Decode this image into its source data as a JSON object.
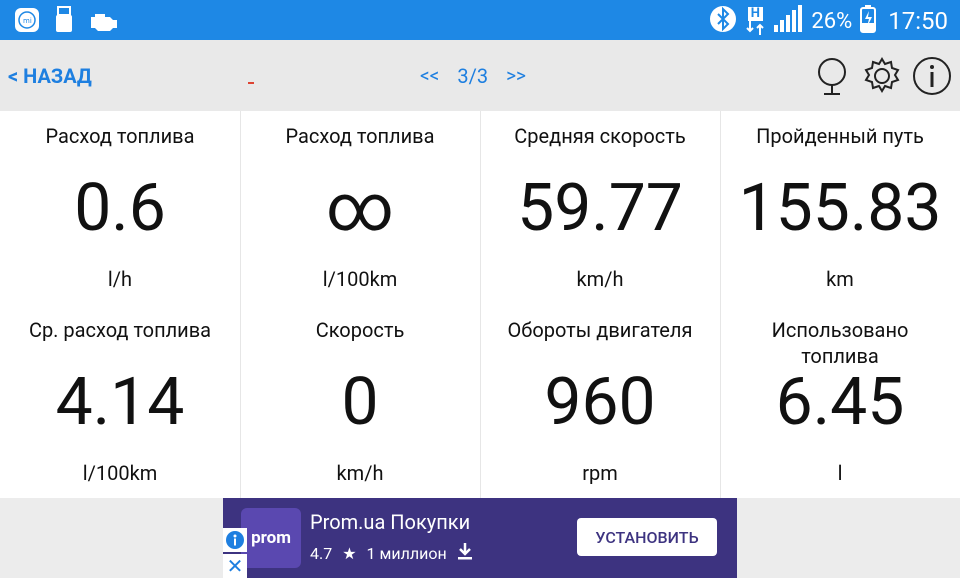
{
  "status_bar": {
    "signal_label": "H",
    "battery_percent": "26%",
    "time": "17:50"
  },
  "toolbar": {
    "back_label": "< НАЗАД",
    "prev_label": "<<",
    "page_indicator": "3/3",
    "next_label": ">>"
  },
  "cells": [
    {
      "title": "Расход топлива",
      "value": "0.6",
      "unit": "l/h"
    },
    {
      "title": "Расход топлива",
      "value": "∞",
      "unit": "l/100km"
    },
    {
      "title": "Средняя скорость",
      "value": "59.77",
      "unit": "km/h"
    },
    {
      "title": "Пройденный путь",
      "value": "155.83",
      "unit": "km"
    },
    {
      "title": "Ср. расход топлива",
      "value": "4.14",
      "unit": "l/100km"
    },
    {
      "title": "Скорость",
      "value": "0",
      "unit": "km/h"
    },
    {
      "title": "Обороты двигателя",
      "value": "960",
      "unit": "rpm"
    },
    {
      "title": "Использовано топлива",
      "value": "6.45",
      "unit": "l"
    }
  ],
  "ad": {
    "app_name": "Prom.ua Покупки",
    "rating": "4.7",
    "downloads": "1 миллион",
    "logo_text": "prom",
    "install_label": "УСТАНОВИТЬ",
    "accent_color": "#3d3380"
  },
  "colors": {
    "status_bar": "#1e88e5",
    "link": "#1e7fe0"
  }
}
